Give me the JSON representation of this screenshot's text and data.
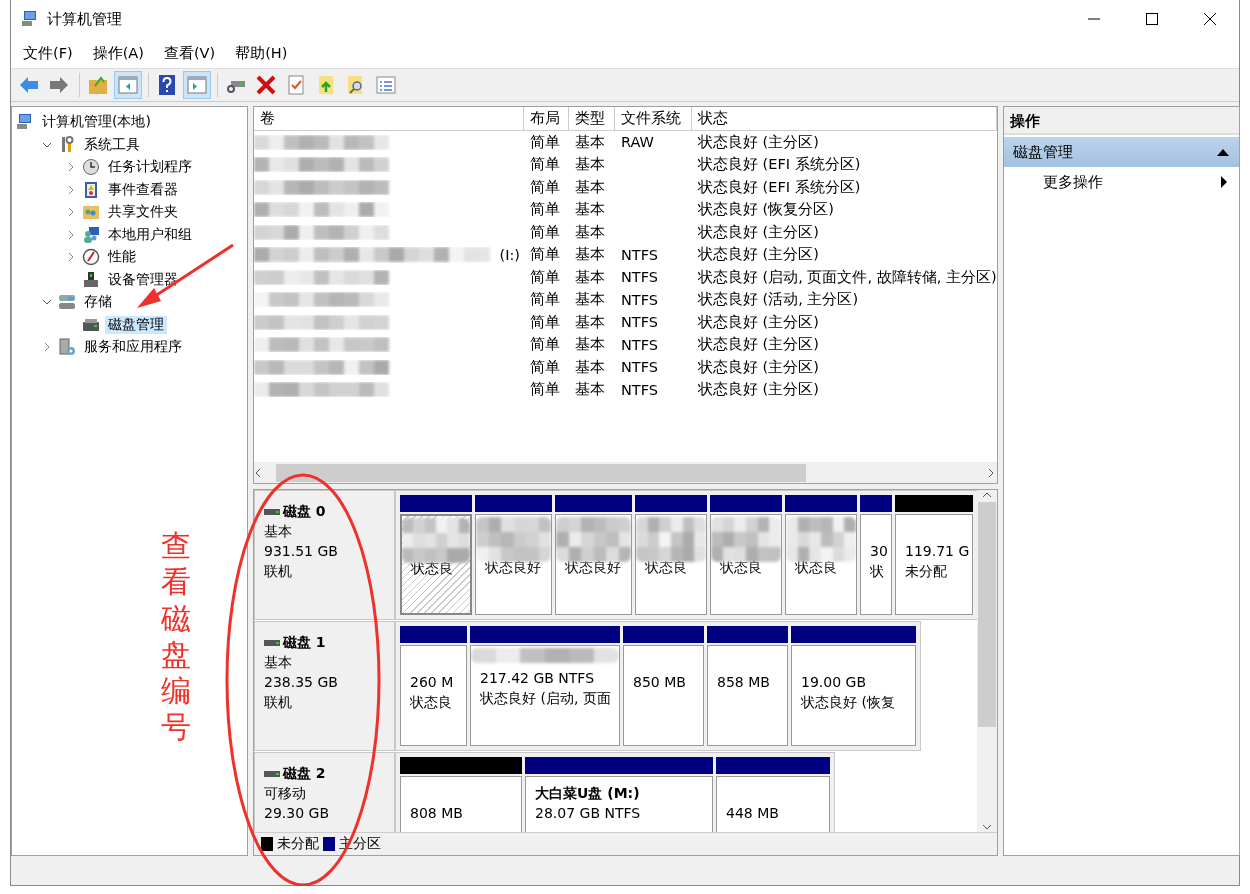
{
  "window": {
    "title": "计算机管理"
  },
  "menu": [
    "文件(F)",
    "操作(A)",
    "查看(V)",
    "帮助(H)"
  ],
  "toolbar": [
    {
      "kind": "back",
      "pressed": false
    },
    {
      "kind": "forward",
      "pressed": false
    },
    {
      "kind": "sep"
    },
    {
      "kind": "up",
      "pressed": false
    },
    {
      "kind": "tree",
      "pressed": true
    },
    {
      "kind": "sep"
    },
    {
      "kind": "help",
      "pressed": false
    },
    {
      "kind": "action",
      "pressed": true
    },
    {
      "kind": "sep"
    },
    {
      "kind": "connect",
      "pressed": false
    },
    {
      "kind": "delete",
      "pressed": false
    },
    {
      "kind": "properties",
      "pressed": false
    },
    {
      "kind": "export",
      "pressed": false
    },
    {
      "kind": "find",
      "pressed": false
    },
    {
      "kind": "list",
      "pressed": false
    }
  ],
  "tree": [
    {
      "label": "计算机管理(本地)",
      "selected": false,
      "children": [
        {
          "label": "系统工具",
          "expanded": true,
          "selected": false,
          "children": [
            {
              "label": "任务计划程序",
              "expanded": false,
              "selected": false
            },
            {
              "label": "事件查看器",
              "expanded": false,
              "selected": false
            },
            {
              "label": "共享文件夹",
              "expanded": false,
              "selected": false
            },
            {
              "label": "本地用户和组",
              "expanded": false,
              "selected": false
            },
            {
              "label": "性能",
              "expanded": false,
              "selected": false
            },
            {
              "label": "设备管理器",
              "selected": false
            }
          ]
        },
        {
          "label": "存储",
          "expanded": true,
          "selected": false,
          "children": [
            {
              "label": "磁盘管理",
              "selected": true
            }
          ]
        },
        {
          "label": "服务和应用程序",
          "expanded": false,
          "selected": false
        }
      ]
    }
  ],
  "table": {
    "columns": [
      "卷",
      "布局",
      "类型",
      "文件系统",
      "状态"
    ],
    "rows": [
      {
        "layout": "简单",
        "type": "基本",
        "fs": "RAW",
        "status": "状态良好 (主分区)"
      },
      {
        "layout": "简单",
        "type": "基本",
        "status": "状态良好 (EFI 系统分区)"
      },
      {
        "layout": "简单",
        "type": "基本",
        "status": "状态良好 (EFI 系统分区)"
      },
      {
        "layout": "简单",
        "type": "基本",
        "status": "状态良好 (恢复分区)"
      },
      {
        "layout": "简单",
        "type": "基本",
        "status": "状态良好 (主分区)"
      },
      {
        "volume": "(I:)",
        "layout": "简单",
        "type": "基本",
        "fs": "NTFS",
        "status": "状态良好 (主分区)"
      },
      {
        "layout": "简单",
        "type": "基本",
        "fs": "NTFS",
        "status": "状态良好 (启动, 页面文件, 故障转储, 主分区)"
      },
      {
        "layout": "简单",
        "type": "基本",
        "fs": "NTFS",
        "status": "状态良好 (活动, 主分区)"
      },
      {
        "layout": "简单",
        "type": "基本",
        "fs": "NTFS",
        "status": "状态良好 (主分区)"
      },
      {
        "layout": "简单",
        "type": "基本",
        "fs": "NTFS",
        "status": "状态良好 (主分区)"
      },
      {
        "layout": "简单",
        "type": "基本",
        "fs": "NTFS",
        "status": "状态良好 (主分区)"
      },
      {
        "layout": "简单",
        "type": "基本",
        "fs": "NTFS",
        "status": "状态良好 (主分区)"
      }
    ]
  },
  "disks": [
    {
      "name": "磁盘 0",
      "type": "基本",
      "size": "931.51 GB",
      "status": "联机",
      "partitions": [
        {
          "color": "#000080",
          "selected": true,
          "status": "状态良"
        },
        {
          "color": "#000080",
          "selected": false,
          "status": "状态良好"
        },
        {
          "color": "#000080",
          "selected": false,
          "status": "状态良好"
        },
        {
          "color": "#000080",
          "selected": false,
          "status": "状态良"
        },
        {
          "color": "#000080",
          "selected": false,
          "status": "状态良"
        },
        {
          "color": "#000080",
          "selected": false,
          "status": "状态良"
        },
        {
          "color": "#000080",
          "selected": false,
          "size": "30",
          "status": "状"
        },
        {
          "color": "#000000",
          "selected": false,
          "size": "119.71 G",
          "status": "未分配"
        }
      ]
    },
    {
      "name": "磁盘 1",
      "type": "基本",
      "size": "238.35 GB",
      "status": "联机",
      "partitions": [
        {
          "color": "#000080",
          "selected": false,
          "size": "260 M",
          "status": "状态良"
        },
        {
          "color": "#000080",
          "selected": false,
          "size": "217.42 GB NTFS",
          "status": "状态良好 (启动, 页面"
        },
        {
          "color": "#000080",
          "selected": false,
          "size": "850 MB"
        },
        {
          "color": "#000080",
          "selected": false,
          "size": "858 MB"
        },
        {
          "color": "#000080",
          "selected": false,
          "size": "19.00 GB",
          "status": "状态良好 (恢复"
        }
      ]
    },
    {
      "name": "磁盘 2",
      "type": "可移动",
      "size": "29.30 GB",
      "partitions": [
        {
          "color": "#000000",
          "selected": false,
          "size": "808 MB"
        },
        {
          "color": "#000080",
          "selected": false,
          "title": "大白菜U盘 (M:)",
          "size": "28.07 GB NTFS"
        },
        {
          "color": "#000080",
          "selected": false,
          "size": "448 MB"
        }
      ]
    }
  ],
  "legend": [
    {
      "label": "未分配",
      "color": "#000000"
    },
    {
      "label": "主分区",
      "color": "#000080"
    }
  ],
  "actions": {
    "header": "操作",
    "section": "磁盘管理",
    "items": [
      "更多操作"
    ]
  },
  "annotation": {
    "note": "查看磁盘编号"
  }
}
